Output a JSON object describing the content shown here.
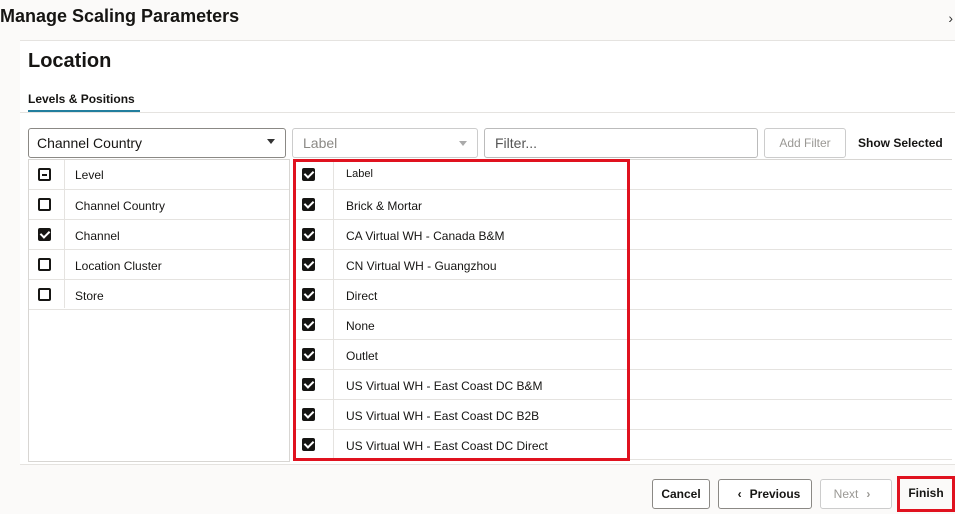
{
  "dialog": {
    "title": "Manage Scaling Parameters",
    "close": "›"
  },
  "section": {
    "title": "Location",
    "tab": "Levels & Positions"
  },
  "toolbar": {
    "level_select": "Channel Country",
    "label_select_placeholder": "Label",
    "filter_placeholder": "Filter...",
    "add_filter": "Add Filter",
    "show_selected": "Show Selected"
  },
  "levels": {
    "header": "Level",
    "header_state": "mixed",
    "rows": [
      {
        "label": "Channel Country",
        "checked": false
      },
      {
        "label": "Channel",
        "checked": true
      },
      {
        "label": "Location Cluster",
        "checked": false
      },
      {
        "label": "Store",
        "checked": false
      }
    ]
  },
  "positions": {
    "header": "Label",
    "header_state": "checked",
    "rows": [
      {
        "label": "Brick & Mortar",
        "checked": true
      },
      {
        "label": "CA Virtual WH - Canada B&M",
        "checked": true
      },
      {
        "label": "CN Virtual WH - Guangzhou",
        "checked": true
      },
      {
        "label": "Direct",
        "checked": true
      },
      {
        "label": "None",
        "checked": true
      },
      {
        "label": "Outlet",
        "checked": true
      },
      {
        "label": "US Virtual WH - East Coast DC B&M",
        "checked": true
      },
      {
        "label": "US Virtual WH - East Coast DC B2B",
        "checked": true
      },
      {
        "label": "US Virtual WH - East Coast DC Direct",
        "checked": true
      }
    ]
  },
  "footer": {
    "cancel": "Cancel",
    "previous": "Previous",
    "next": "Next",
    "finish": "Finish"
  },
  "colors": {
    "accent": "#227e9e",
    "highlight": "#e0121f"
  }
}
